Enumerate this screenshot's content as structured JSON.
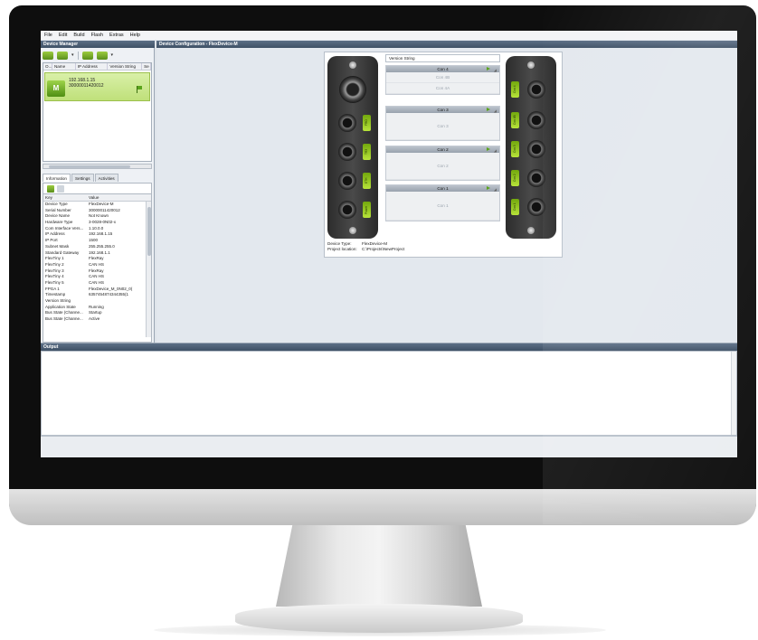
{
  "menu": [
    "File",
    "Edit",
    "Build",
    "Flash",
    "Extras",
    "Help"
  ],
  "device_manager": {
    "title": "Device Manager",
    "columns": [
      "O...",
      "Name",
      "IP Address",
      "Version String",
      "Se"
    ],
    "device": {
      "ip": "192.168.1.15",
      "serial": "30000011420012",
      "icon_letter": "M"
    }
  },
  "tabs": [
    "Information",
    "Settings",
    "Activities"
  ],
  "info_table": {
    "headers": [
      "Key",
      "Value"
    ],
    "rows": [
      [
        "Device Type",
        "FlexDevice-M"
      ],
      [
        "Serial Number",
        "30000011420012"
      ],
      [
        "Device Name",
        "Not Known"
      ],
      [
        "Hardware Type",
        "3-0028-0N02-x"
      ],
      [
        "Com Interface Vers...",
        "1.10.0.0"
      ],
      [
        "IP Address",
        "192.168.1.15"
      ],
      [
        "IP Port",
        "1500"
      ],
      [
        "Subnet Mask",
        "255.255.255.0"
      ],
      [
        "Standard Gateway",
        "192.168.1.1"
      ],
      [
        "FlexTiny 1",
        "FlexRay"
      ],
      [
        "FlexTiny 2",
        "CAN HS"
      ],
      [
        "FlexTiny 3",
        "FlexRay"
      ],
      [
        "FlexTiny 4",
        "CAN HS"
      ],
      [
        "FlexTiny 5",
        "CAN HS"
      ],
      [
        "FPGA 1",
        "FlexDevice_M_0N02_0("
      ],
      [
        "Timestamp",
        "6357454874344355(1"
      ],
      [
        "Version String",
        ""
      ],
      [
        "Application State",
        "Running"
      ],
      [
        "Bus State (Channe...",
        "Startup"
      ],
      [
        "Bus State (Channe...",
        "Active"
      ]
    ]
  },
  "device_config": {
    "title": "Device Configuration - FlexDevice-M",
    "version_string": "Version String",
    "connectors": [
      {
        "name": "Con 4",
        "subs": [
          "Con 4B",
          "Con 4A"
        ]
      },
      {
        "name": "Con 3",
        "subs": [
          "Con 3"
        ]
      },
      {
        "name": "Con 2",
        "subs": [
          "Con 2"
        ]
      },
      {
        "name": "Con 1",
        "subs": [
          "Con 1"
        ]
      }
    ],
    "left_tags": [
      "FRO",
      "TR3",
      "ETH",
      "Power"
    ],
    "right_tags": [
      "Con 4",
      "Con 4B",
      "Con 3",
      "Con 2",
      "Con 1"
    ],
    "device_type_label": "Device Type:",
    "device_type_value": "FlexDevice-M",
    "project_location_label": "Project location:",
    "project_location_value": "C:\\Projects\\NewProject"
  },
  "output": {
    "title": "Output"
  },
  "colors": {
    "accent_green": "#8cc63f",
    "title_bar": "#4b5d73"
  }
}
